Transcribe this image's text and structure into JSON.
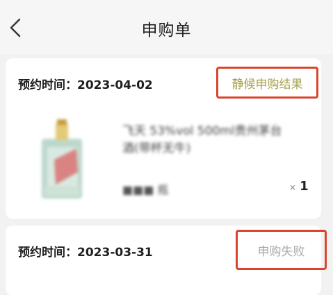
{
  "header": {
    "title": "申购单",
    "back_icon": "chevron-left-icon"
  },
  "orders": [
    {
      "reserve_label": "预约时间：2023-04-02",
      "status": "静候申购结果",
      "status_color": "#a8a14a",
      "product": {
        "name": "飞天 53%vol 500ml贵州茅台酒(带杯无牛)",
        "spec": "■■■ 瓶",
        "quantity_prefix": "×",
        "quantity": "1"
      }
    },
    {
      "reserve_label": "预约时间：2023-03-31",
      "status": "申购失败",
      "status_color": "#a9a9a9"
    }
  ],
  "colors": {
    "highlight_border": "#d9442d",
    "background": "#f2f2f2",
    "card": "#ffffff"
  }
}
